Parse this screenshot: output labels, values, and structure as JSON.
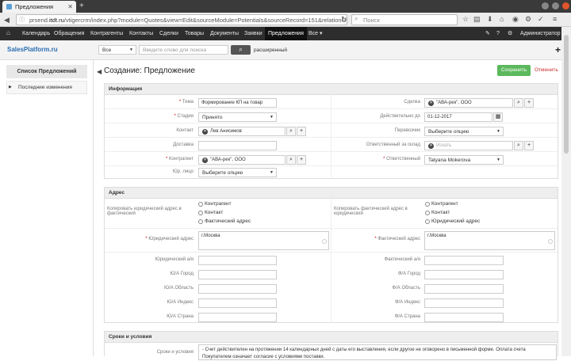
{
  "browser": {
    "tab_title": "Предложения",
    "url_prefix": "prsend.",
    "url_host": "itdt.ru",
    "url_path": "/vtigercrm/index.php?module=Quotes&view=Edit&sourceModule=Potentials&sourceRecord=151&relationOpera",
    "search_placeholder": "Поиск"
  },
  "nav": {
    "items": [
      "Календарь",
      "Обращения",
      "Контрагенты",
      "Контакты",
      "Сделки",
      "Товары",
      "Документы",
      "Заявки",
      "Предложения",
      "Все ▾"
    ],
    "user": "Администратор ▾"
  },
  "appbar": {
    "logo": "SalesPlatform.ru",
    "scope": "Все",
    "search_placeholder": "Введите слово для поиска",
    "advanced": "расширенный"
  },
  "sidebar": {
    "title": "Список Предложений",
    "item": "Последние изменения"
  },
  "page": {
    "title": "Создание: Предложение",
    "save": "Сохранить",
    "cancel": "Отменить"
  },
  "info": {
    "header": "Информация",
    "theme_label": "Тема",
    "theme": "Формирование КП на товар",
    "deal_label": "Сделка",
    "deal": "\"АВА-рек\", ООО",
    "stage_label": "Стадия",
    "stage": "Принято",
    "valid_label": "Действительно до",
    "valid": "01-12-2017",
    "contact_label": "Контакт",
    "contact": "Лев Анисимов",
    "carrier_label": "Перевозчик",
    "carrier": "Выберите опцию",
    "delivery_label": "Доставка",
    "warehouse_label": "Ответственный за склад",
    "warehouse_placeholder": "Искать",
    "account_label": "Контрагент",
    "account": "\"АВА-рек\", ООО",
    "assigned_label": "Ответственный",
    "assigned": "Tatyana Mokerova",
    "legal_label": "Юр. лицо",
    "legal": "Выберите опцию"
  },
  "address": {
    "header": "Адрес",
    "copy_legal": "Копировать юридический адрес в фактический",
    "copy_fact": "Копировать фактический адрес в юридический",
    "opts_left": [
      "Контрагент",
      "Контакт",
      "Фактический адрес"
    ],
    "opts_right": [
      "Контрагент",
      "Контакт",
      "Юридический адрес"
    ],
    "legal_addr_label": "Юридический адрес",
    "legal_addr": "г.Москва",
    "fact_addr_label": "Фактический адрес",
    "fact_addr": "г.Москва",
    "left_labels": [
      "Юридический а/я",
      "Ю/А Город",
      "Ю/А Область",
      "Ю/А Индекс",
      "Ю/А Страна"
    ],
    "right_labels": [
      "Фактический а/я",
      "Ф/А Город",
      "Ф/А Область",
      "Ф/А Индекс",
      "Ф/А Страна"
    ]
  },
  "terms": {
    "header": "Сроки и условия",
    "label": "Сроки и условия",
    "text": "- Счет действителен на протяжении 14 календарных дней с даты его выставления, если другое не оговорено в письменной форме. Оплата счета Покупателем означает согласие с условиями поставки."
  }
}
